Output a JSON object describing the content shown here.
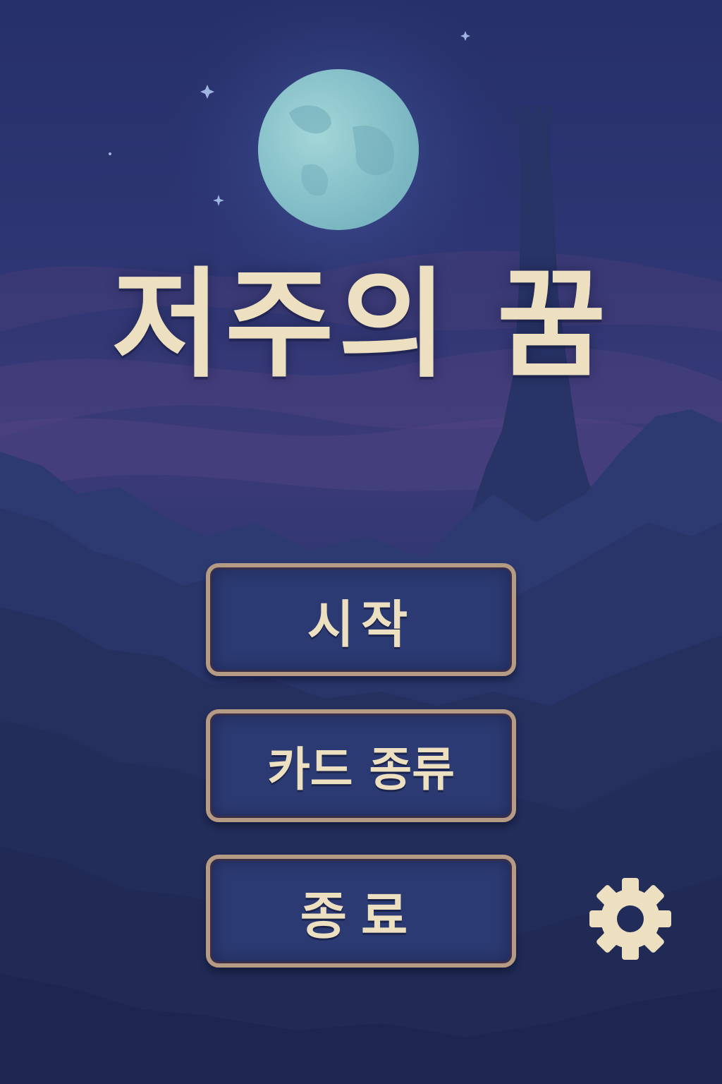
{
  "game": {
    "title": "저주의 꿈"
  },
  "menu": {
    "items": [
      {
        "label": "시작"
      },
      {
        "label": "카드 종류"
      },
      {
        "label": "종료"
      }
    ]
  },
  "settings": {
    "icon": "gear-icon"
  },
  "colors": {
    "sky_dark": "#1f2a5c",
    "sky_purple": "#4a3f7a",
    "moon": "#8fc6cc",
    "text_cream": "#ece0c0",
    "button_fill": "#2b3a72",
    "button_border": "#b59a84"
  }
}
